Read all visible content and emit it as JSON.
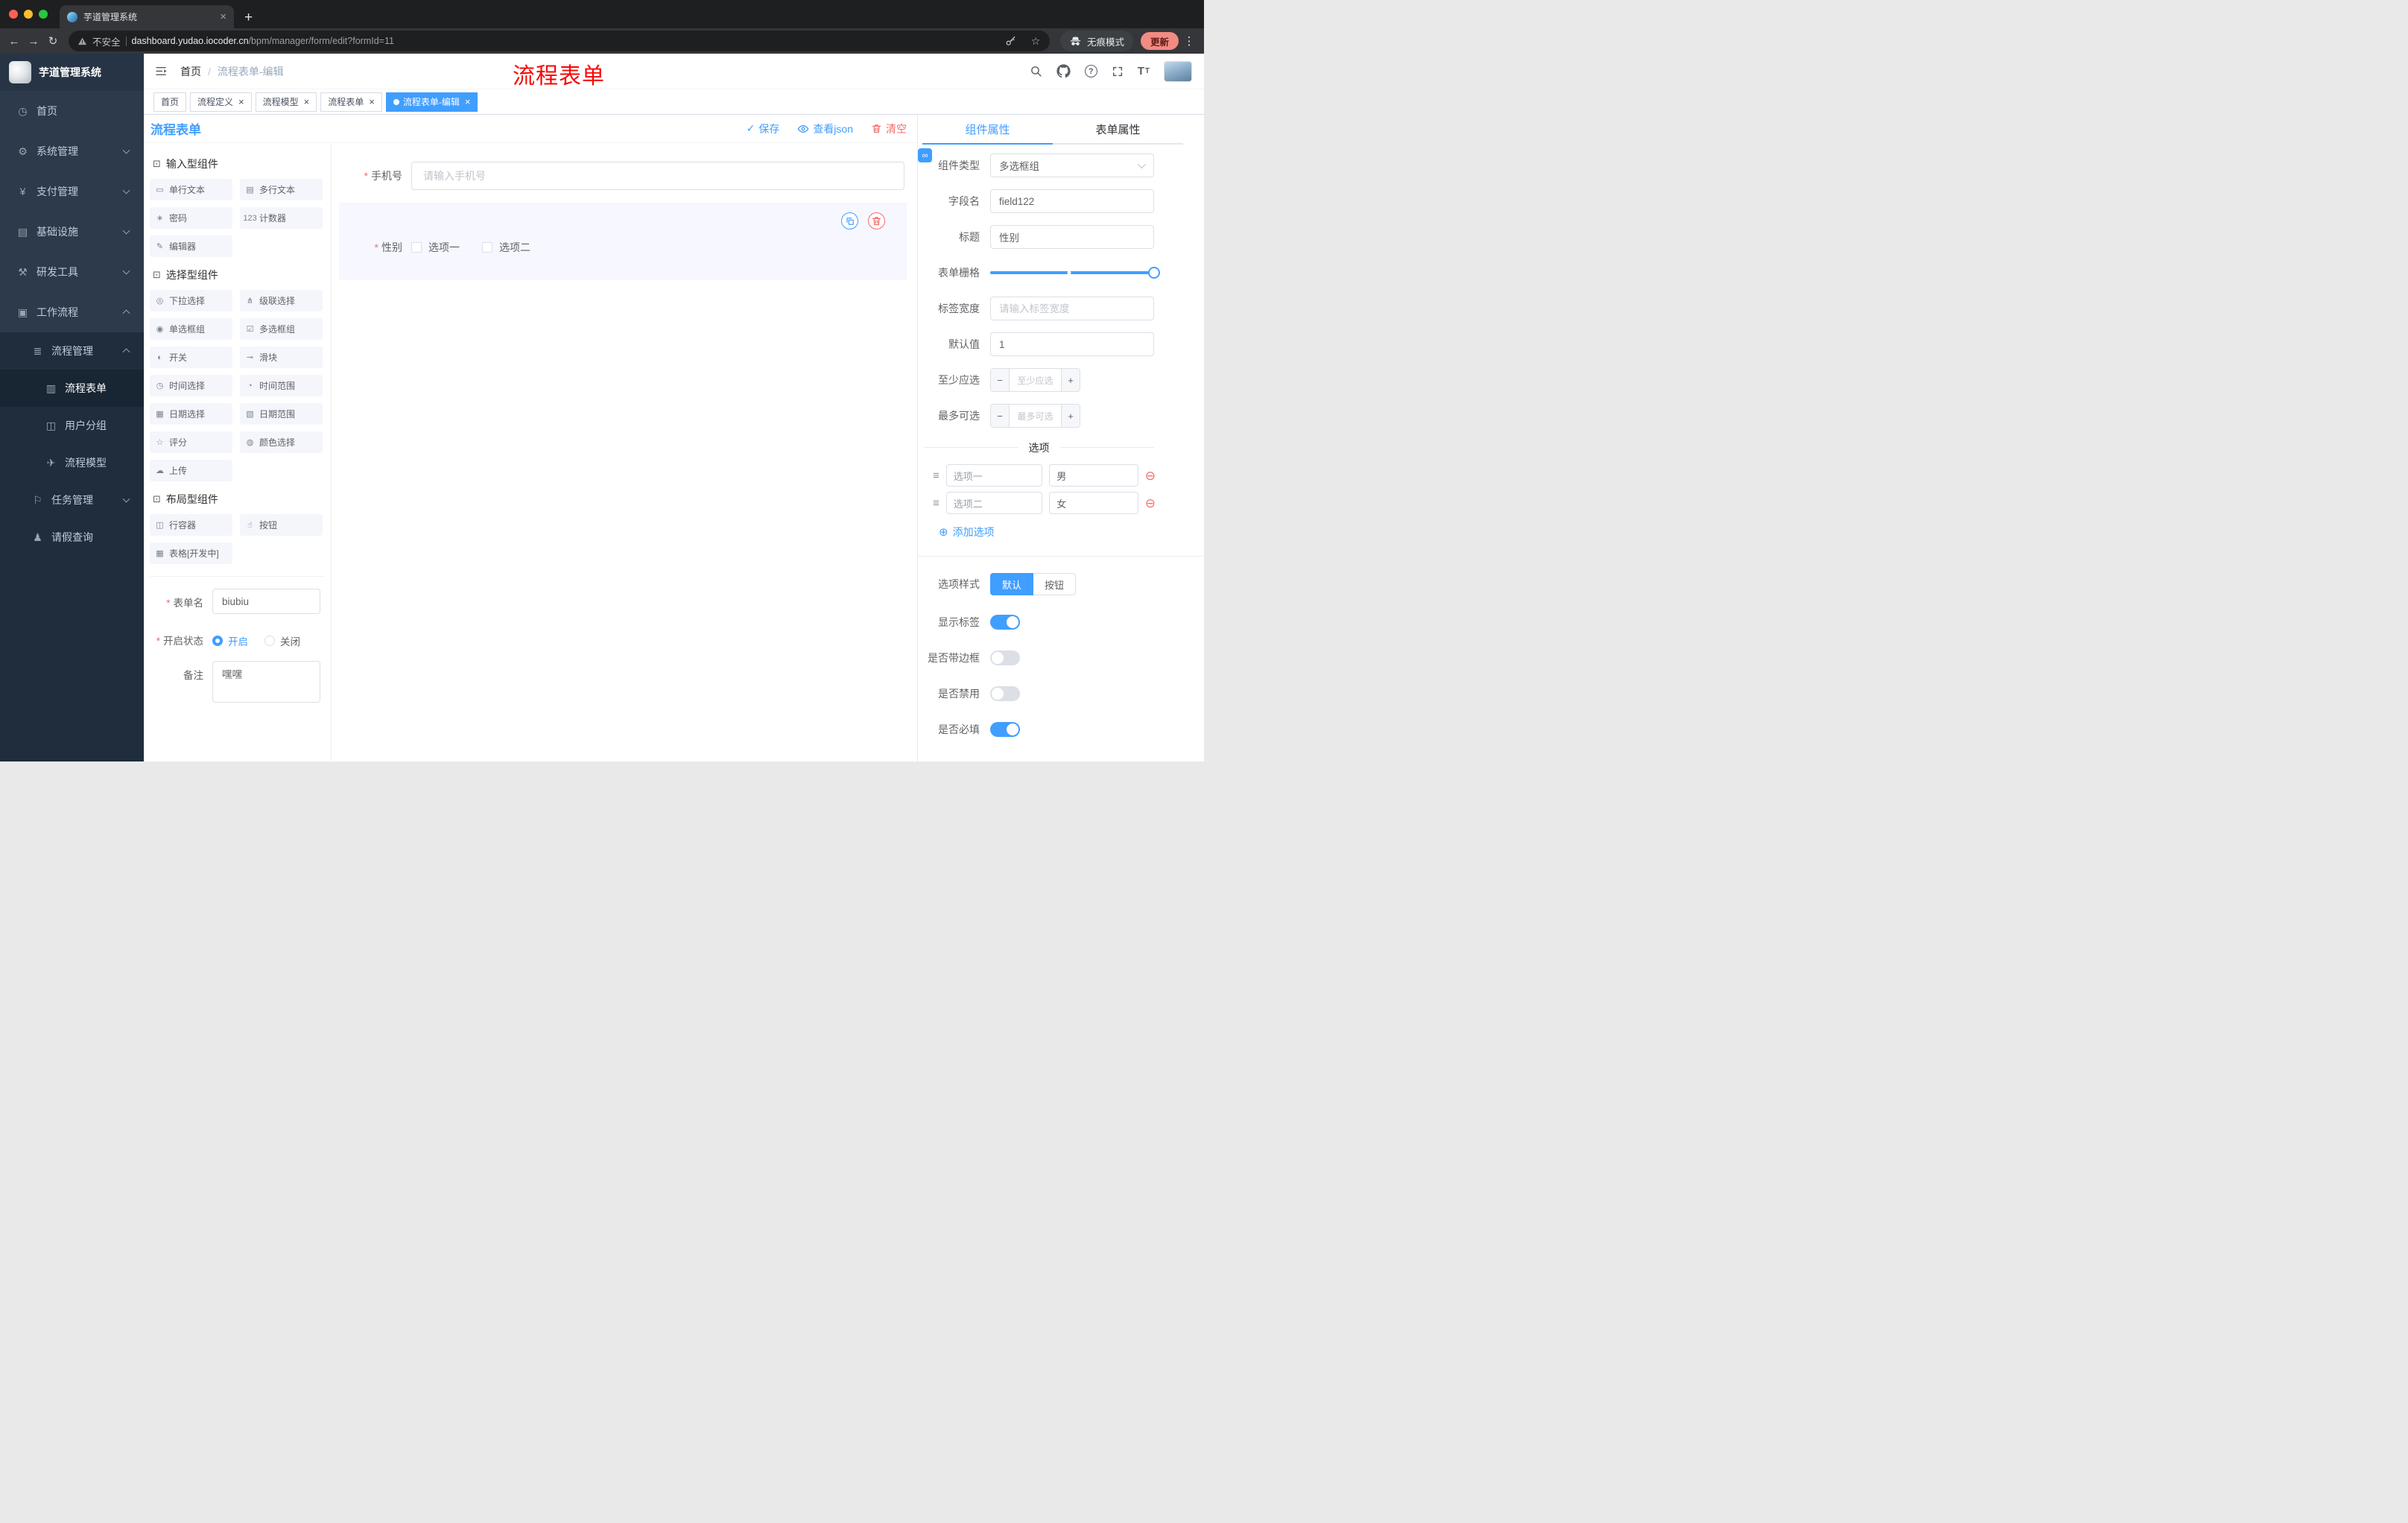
{
  "browser": {
    "tab": {
      "title": "芋道管理系统"
    },
    "address": {
      "security": "不安全",
      "domain": "dashboard.yudao.iocoder.cn",
      "path": "/bpm/manager/form/edit?formId=11"
    },
    "incognito_label": "无痕模式",
    "update_label": "更新"
  },
  "sidebar": {
    "logo_title": "芋道管理系统",
    "menu": [
      {
        "key": "home",
        "label": "首页",
        "icon": "dashboard-icon",
        "level": 0
      },
      {
        "key": "system",
        "label": "系统管理",
        "icon": "gear-icon",
        "level": 0,
        "chevron": "down"
      },
      {
        "key": "payment",
        "label": "支付管理",
        "icon": "payment-icon",
        "level": 0,
        "chevron": "down"
      },
      {
        "key": "infra",
        "label": "基础设施",
        "icon": "infra-icon",
        "level": 0,
        "chevron": "down"
      },
      {
        "key": "devtools",
        "label": "研发工具",
        "icon": "tools-icon",
        "level": 0,
        "chevron": "down"
      },
      {
        "key": "workflow",
        "label": "工作流程",
        "icon": "workflow-icon",
        "level": 0,
        "chevron": "up"
      },
      {
        "key": "process-mgmt",
        "label": "流程管理",
        "icon": "process-icon",
        "level": 1,
        "chevron": "up",
        "dark": true
      },
      {
        "key": "process-form",
        "label": "流程表单",
        "icon": "form-icon",
        "level": 2,
        "dark": true,
        "active": true
      },
      {
        "key": "user-group",
        "label": "用户分组",
        "icon": "users-icon",
        "level": 2,
        "dark": true
      },
      {
        "key": "process-model",
        "label": "流程模型",
        "icon": "model-icon",
        "level": 2,
        "dark": true
      },
      {
        "key": "task-mgmt",
        "label": "任务管理",
        "icon": "task-icon",
        "level": 1,
        "chevron": "down",
        "dark": true
      },
      {
        "key": "leave-query",
        "label": "请假查询",
        "icon": "person-icon",
        "level": 1,
        "dark": true
      }
    ]
  },
  "header": {
    "breadcrumb": {
      "home": "首页",
      "sep": "/",
      "current": "流程表单-编辑"
    },
    "annotation": "流程表单"
  },
  "view_tabs": [
    {
      "key": "home",
      "label": "首页",
      "closable": false,
      "active": false
    },
    {
      "key": "process-definition",
      "label": "流程定义",
      "closable": true,
      "active": false
    },
    {
      "key": "process-model",
      "label": "流程模型",
      "closable": true,
      "active": false
    },
    {
      "key": "process-form",
      "label": "流程表单",
      "closable": true,
      "active": false
    },
    {
      "key": "process-form-edit",
      "label": "流程表单-编辑",
      "closable": true,
      "active": true
    }
  ],
  "designer": {
    "title": "流程表单",
    "actions": [
      {
        "name": "save-button",
        "label": "保存",
        "icon": "check-icon",
        "type": "primary"
      },
      {
        "name": "view-json-button",
        "label": "查看json",
        "icon": "eye-icon",
        "type": "primary"
      },
      {
        "name": "clear-button",
        "label": "清空",
        "icon": "trash-icon",
        "type": "danger"
      }
    ],
    "palette_sections": [
      {
        "title": "输入型组件",
        "items": [
          {
            "label": "单行文本",
            "icon": "single-line-icon"
          },
          {
            "label": "多行文本",
            "icon": "multi-line-icon"
          },
          {
            "label": "密码",
            "icon": "password-icon"
          },
          {
            "label": "计数器",
            "icon": "counter-icon"
          },
          {
            "label": "编辑器",
            "icon": "editor-icon"
          }
        ]
      },
      {
        "title": "选择型组件",
        "items": [
          {
            "label": "下拉选择",
            "icon": "select-icon"
          },
          {
            "label": "级联选择",
            "icon": "cascade-icon"
          },
          {
            "label": "单选框组",
            "icon": "radio-group-icon"
          },
          {
            "label": "多选框组",
            "icon": "checkbox-group-icon"
          },
          {
            "label": "开关",
            "icon": "switch-icon"
          },
          {
            "label": "滑块",
            "icon": "slider-icon"
          },
          {
            "label": "时间选择",
            "icon": "time-icon"
          },
          {
            "label": "时间范围",
            "icon": "time-range-icon"
          },
          {
            "label": "日期选择",
            "icon": "date-icon"
          },
          {
            "label": "日期范围",
            "icon": "date-range-icon"
          },
          {
            "label": "评分",
            "icon": "rate-icon"
          },
          {
            "label": "颜色选择",
            "icon": "color-icon"
          },
          {
            "label": "上传",
            "icon": "upload-icon"
          }
        ]
      },
      {
        "title": "布局型组件",
        "items": [
          {
            "label": "行容器",
            "icon": "row-container-icon"
          },
          {
            "label": "按钮",
            "icon": "button-icon"
          },
          {
            "label": "表格[开发中]",
            "icon": "table-icon"
          }
        ]
      }
    ],
    "meta_form": {
      "name": {
        "label": "表单名",
        "value": "biubiu",
        "required": true
      },
      "status": {
        "label": "开启状态",
        "required": true,
        "options": [
          {
            "label": "开启",
            "checked": true
          },
          {
            "label": "关闭",
            "checked": false
          }
        ]
      },
      "remark": {
        "label": "备注",
        "value": "嘿嘿"
      }
    },
    "canvas": {
      "phone": {
        "label": "手机号",
        "placeholder": "请输入手机号",
        "required": true
      },
      "gender": {
        "label": "性别",
        "required": true,
        "options": [
          "选项一",
          "选项二"
        ]
      }
    }
  },
  "props": {
    "tabs": [
      {
        "label": "组件属性",
        "active": true
      },
      {
        "label": "表单属性",
        "active": false
      }
    ],
    "fields": [
      {
        "key": "component-type",
        "label": "组件类型",
        "type": "select",
        "value": "多选框组"
      },
      {
        "key": "field-name",
        "label": "字段名",
        "type": "input",
        "value": "field122"
      },
      {
        "key": "title",
        "label": "标题",
        "type": "input",
        "value": "性别"
      },
      {
        "key": "form-grid",
        "label": "表单栅格",
        "type": "slider"
      },
      {
        "key": "label-width",
        "label": "标签宽度",
        "type": "input",
        "placeholder": "请输入标签宽度"
      },
      {
        "key": "default-value",
        "label": "默认值",
        "type": "input",
        "value": "1"
      },
      {
        "key": "min-select",
        "label": "至少应选",
        "type": "stepper",
        "placeholder": "至少应选"
      },
      {
        "key": "max-select",
        "label": "最多可选",
        "type": "stepper",
        "placeholder": "最多可选"
      }
    ],
    "options_section": {
      "title": "选项",
      "rows": [
        {
          "label": "选项一",
          "value": "男"
        },
        {
          "label": "选项二",
          "value": "女"
        }
      ],
      "add_label": "添加选项"
    },
    "style_row": {
      "label": "选项样式",
      "options": [
        {
          "label": "默认",
          "active": true
        },
        {
          "label": "按钮",
          "active": false
        }
      ]
    },
    "switches": [
      {
        "key": "show-label",
        "label": "显示标签",
        "on": true
      },
      {
        "key": "bordered",
        "label": "是否带边框",
        "on": false
      },
      {
        "key": "disabled",
        "label": "是否禁用",
        "on": false
      },
      {
        "key": "required",
        "label": "是否必填",
        "on": true
      }
    ]
  },
  "colors": {
    "primary": "#409eff",
    "danger": "#f56c6c",
    "annotation": "#f60606"
  },
  "icon_glyphs": {
    "dashboard-icon": "◷",
    "gear-icon": "⚙",
    "payment-icon": "¥",
    "infra-icon": "▤",
    "tools-icon": "⚒",
    "workflow-icon": "▣",
    "process-icon": "≣",
    "form-icon": "▥",
    "users-icon": "◫",
    "model-icon": "✈",
    "task-icon": "⚐",
    "person-icon": "♟",
    "single-line-icon": "▭",
    "multi-line-icon": "▤",
    "password-icon": "∗",
    "counter-icon": "123",
    "editor-icon": "✎",
    "select-icon": "◎",
    "cascade-icon": "⋔",
    "radio-group-icon": "◉",
    "checkbox-group-icon": "☑",
    "switch-icon": "◐",
    "slider-icon": "⊸",
    "time-icon": "◷",
    "time-range-icon": "◔",
    "date-icon": "▦",
    "date-range-icon": "▧",
    "rate-icon": "☆",
    "color-icon": "◍",
    "upload-icon": "☁",
    "row-container-icon": "◫",
    "button-icon": "☝",
    "table-icon": "▦",
    "section-cube-icon": "⊡",
    "check-icon": "✓",
    "drag-handle-icon": "≡",
    "remove-circle-icon": "⊖",
    "plus-circle-icon": "⊕",
    "link-icon": "∞",
    "back-icon": "←",
    "forward-icon": "→",
    "reload-icon": "↻",
    "close-icon": "×",
    "plus-icon": "+",
    "kebab-icon": "⋮",
    "star-icon": "☆",
    "question-icon": "?",
    "minus-icon": "−"
  }
}
